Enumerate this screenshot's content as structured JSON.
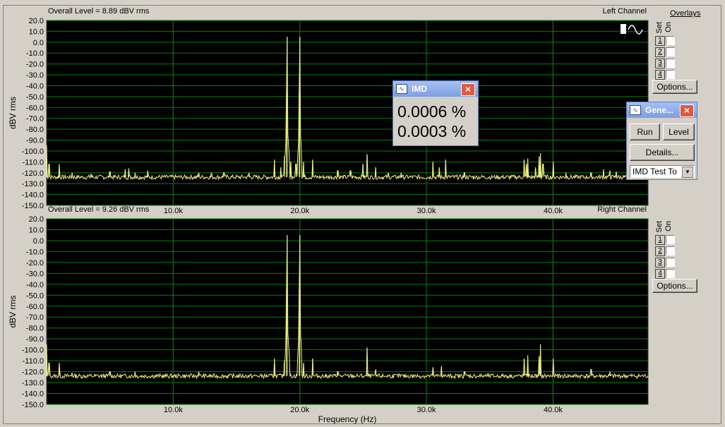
{
  "top": {
    "overall_level": "Overall Level = 8.89 dBV rms",
    "channel": "Left Channel"
  },
  "bottom": {
    "overall_level": "Overall Level = 9.26 dBV rms",
    "channel": "Right Channel"
  },
  "overlays": {
    "title": "Overlays",
    "col_set": "Set",
    "col_on": "On",
    "rows": [
      "1",
      "2",
      "3",
      "4"
    ],
    "options_label": "Options..."
  },
  "imd_window": {
    "title": "IMD",
    "value1": "0.0006 %",
    "value2": "0.0003 %"
  },
  "gen_window": {
    "title": "Gene...",
    "run_label": "Run",
    "level_label": "Level",
    "details_label": "Details...",
    "select_value": "IMD Test To"
  },
  "colors": {
    "plot_bg": "#000000",
    "grid": "#008000",
    "trace": "#f0f080",
    "chrome": "#d4d0c8"
  },
  "chart_data": [
    {
      "type": "line",
      "title": "Left Channel",
      "subtitle": "Overall Level = 8.89 dBV rms",
      "xlabel": "",
      "ylabel": "dBV rms",
      "xlim": [
        0,
        47500
      ],
      "ylim": [
        -150,
        20
      ],
      "x_ticks": [
        10000,
        20000,
        30000,
        40000
      ],
      "x_tick_labels": [
        "10.0k",
        "20.0k",
        "30.0k",
        "40.0k"
      ],
      "y_ticks": [
        20,
        10,
        0,
        -10,
        -20,
        -30,
        -40,
        -50,
        -60,
        -70,
        -80,
        -90,
        -100,
        -110,
        -120,
        -130,
        -140,
        -150
      ],
      "y_tick_labels": [
        "20.0",
        "10.0",
        "0.0",
        "-10.0",
        "-20.0",
        "-30.0",
        "-40.0",
        "-50.0",
        "-60.0",
        "-70.0",
        "-80.0",
        "-90.0",
        "-100.0",
        "-110.0",
        "-120.0",
        "-130.0",
        "-140.0",
        "-150.0"
      ],
      "grid": true,
      "noise_floor": -124,
      "peaks": [
        {
          "x": 0,
          "y": -95
        },
        {
          "x": 200,
          "y": -112
        },
        {
          "x": 1000,
          "y": -112
        },
        {
          "x": 2000,
          "y": -120
        },
        {
          "x": 3500,
          "y": -121
        },
        {
          "x": 5000,
          "y": -119
        },
        {
          "x": 6200,
          "y": -117
        },
        {
          "x": 6500,
          "y": -116
        },
        {
          "x": 7000,
          "y": -120
        },
        {
          "x": 8000,
          "y": -118
        },
        {
          "x": 12000,
          "y": -120
        },
        {
          "x": 13000,
          "y": -120
        },
        {
          "x": 14000,
          "y": -120
        },
        {
          "x": 16000,
          "y": -120
        },
        {
          "x": 18000,
          "y": -108
        },
        {
          "x": 18500,
          "y": -115
        },
        {
          "x": 18800,
          "y": -105
        },
        {
          "x": 18950,
          "y": -45
        },
        {
          "x": 19000,
          "y": 5
        },
        {
          "x": 19300,
          "y": -110
        },
        {
          "x": 19700,
          "y": -112
        },
        {
          "x": 19950,
          "y": -45
        },
        {
          "x": 20000,
          "y": 5
        },
        {
          "x": 20300,
          "y": -110
        },
        {
          "x": 21000,
          "y": -108
        },
        {
          "x": 23000,
          "y": -118
        },
        {
          "x": 24000,
          "y": -118
        },
        {
          "x": 25300,
          "y": -103
        },
        {
          "x": 25000,
          "y": -112
        },
        {
          "x": 26000,
          "y": -115
        },
        {
          "x": 27000,
          "y": -120
        },
        {
          "x": 28000,
          "y": -120
        },
        {
          "x": 30500,
          "y": -110
        },
        {
          "x": 31000,
          "y": -115
        },
        {
          "x": 31500,
          "y": -108
        },
        {
          "x": 33000,
          "y": -120
        },
        {
          "x": 37700,
          "y": -108
        },
        {
          "x": 37900,
          "y": -112
        },
        {
          "x": 38000,
          "y": -107
        },
        {
          "x": 38600,
          "y": -115
        },
        {
          "x": 38900,
          "y": -105
        },
        {
          "x": 39000,
          "y": -102
        },
        {
          "x": 39200,
          "y": -112
        },
        {
          "x": 40000,
          "y": -110
        },
        {
          "x": 41000,
          "y": -120
        },
        {
          "x": 43000,
          "y": -120
        },
        {
          "x": 44000,
          "y": -117
        },
        {
          "x": 44500,
          "y": -118
        },
        {
          "x": 45000,
          "y": -119
        }
      ]
    },
    {
      "type": "line",
      "title": "Right Channel",
      "subtitle": "Overall Level = 9.26 dBV rms",
      "xlabel": "Frequency (Hz)",
      "ylabel": "dBV rms",
      "xlim": [
        0,
        47500
      ],
      "ylim": [
        -150,
        20
      ],
      "x_ticks": [
        10000,
        20000,
        30000,
        40000
      ],
      "x_tick_labels": [
        "10.0k",
        "20.0k",
        "30.0k",
        "40.0k"
      ],
      "y_ticks": [
        20,
        10,
        0,
        -10,
        -20,
        -30,
        -40,
        -50,
        -60,
        -70,
        -80,
        -90,
        -100,
        -110,
        -120,
        -130,
        -140,
        -150
      ],
      "y_tick_labels": [
        "20.0",
        "10.0",
        "0.0",
        "-10.0",
        "-20.0",
        "-30.0",
        "-40.0",
        "-50.0",
        "-60.0",
        "-70.0",
        "-80.0",
        "-90.0",
        "-100.0",
        "-110.0",
        "-120.0",
        "-130.0",
        "-140.0",
        "-150.0"
      ],
      "grid": true,
      "noise_floor": -124,
      "peaks": [
        {
          "x": 0,
          "y": -95
        },
        {
          "x": 200,
          "y": -112
        },
        {
          "x": 1000,
          "y": -112
        },
        {
          "x": 2000,
          "y": -121
        },
        {
          "x": 5000,
          "y": -120
        },
        {
          "x": 7000,
          "y": -120
        },
        {
          "x": 12000,
          "y": -120
        },
        {
          "x": 18000,
          "y": -108
        },
        {
          "x": 18800,
          "y": -110
        },
        {
          "x": 18950,
          "y": -45
        },
        {
          "x": 19000,
          "y": 5
        },
        {
          "x": 19950,
          "y": -45
        },
        {
          "x": 20000,
          "y": 5
        },
        {
          "x": 20300,
          "y": -112
        },
        {
          "x": 21000,
          "y": -108
        },
        {
          "x": 23000,
          "y": -120
        },
        {
          "x": 25300,
          "y": -98
        },
        {
          "x": 26000,
          "y": -118
        },
        {
          "x": 30500,
          "y": -116
        },
        {
          "x": 31200,
          "y": -115
        },
        {
          "x": 33000,
          "y": -120
        },
        {
          "x": 37700,
          "y": -108
        },
        {
          "x": 38000,
          "y": -105
        },
        {
          "x": 38900,
          "y": -106
        },
        {
          "x": 39000,
          "y": -95
        },
        {
          "x": 40000,
          "y": -108
        },
        {
          "x": 43000,
          "y": -118
        },
        {
          "x": 44500,
          "y": -120
        }
      ]
    }
  ]
}
